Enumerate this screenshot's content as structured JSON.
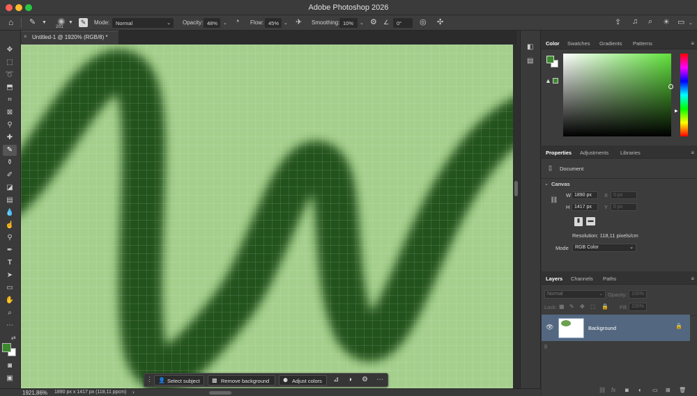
{
  "app": {
    "title": "Adobe Photoshop 2026"
  },
  "options": {
    "brush_size": "201",
    "mode_label": "Mode:",
    "mode_value": "Normal",
    "opacity_label": "Opacity:",
    "opacity_value": "48%",
    "flow_label": "Flow:",
    "flow_value": "45%",
    "smoothing_label": "Smoothing:",
    "smoothing_value": "10%",
    "angle_value": "0°"
  },
  "document": {
    "tab_title": "Untitled-1 @ 1920% (RGB/8) *"
  },
  "colors": {
    "foreground": "#3a8a2c",
    "background": "#ffffff",
    "canvas": "#a5cf8d",
    "stroke": "#1f4d14"
  },
  "color_panel": {
    "tabs": [
      "Color",
      "Swatches",
      "Gradients",
      "Patterns"
    ],
    "active_tab": "Color",
    "swatch_current": "#3a8a2c"
  },
  "properties_panel": {
    "tabs": [
      "Properties",
      "Adjustments",
      "Libraries"
    ],
    "section_document": "Document",
    "section_canvas": "Canvas",
    "w_label": "W",
    "w_value": "1890 px",
    "h_label": "H",
    "h_value": "1417 px",
    "x_label": "X",
    "x_placeholder": "0 px",
    "y_label": "Y",
    "y_placeholder": "0 px",
    "resolution": "Resolution: 118,11 pixels/cm",
    "mode_label": "Mode",
    "mode_value": "RGB Color"
  },
  "layers_panel": {
    "tabs": [
      "Layers",
      "Channels",
      "Paths"
    ],
    "blend_mode": "Normal",
    "opacity_label": "Opacity:",
    "opacity_value": "100%",
    "lock_label": "Lock:",
    "fill_label": "Fill:",
    "fill_value": "100%",
    "layer_name": "Background"
  },
  "status": {
    "zoom": "1921,86%",
    "doc_info": "1890 px x 1417 px (118,11 ppcm)"
  },
  "taskbar": {
    "select_subject": "Select subject",
    "remove_background": "Remove background",
    "adjust_colors": "Adjust colors"
  }
}
